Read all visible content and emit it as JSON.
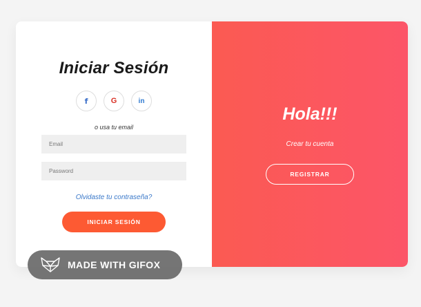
{
  "login": {
    "title": "Iniciar Sesión",
    "social_icons": [
      "facebook-icon",
      "google-icon",
      "linkedin-icon"
    ],
    "social_glyphs": {
      "facebook": "f",
      "google": "G",
      "linkedin": "in"
    },
    "subtitle": "o usa tu email",
    "email_placeholder": "Email",
    "password_placeholder": "Password",
    "forgot_link": "Olvidaste tu contraseña?",
    "submit_label": "INICIAR SESIÓN"
  },
  "signup_panel": {
    "heading": "Hola!!!",
    "subtitle": "Crear tu cuenta",
    "register_label": "REGISTRAR"
  },
  "watermark": {
    "text": "MADE WITH GIFOX",
    "icon": "fox-logo-icon"
  },
  "colors": {
    "background": "#f4f4f4",
    "gradient_start": "#fb5a52",
    "gradient_end": "#fc5568",
    "primary_button": "#fd5a33",
    "link": "#3a78c9"
  }
}
